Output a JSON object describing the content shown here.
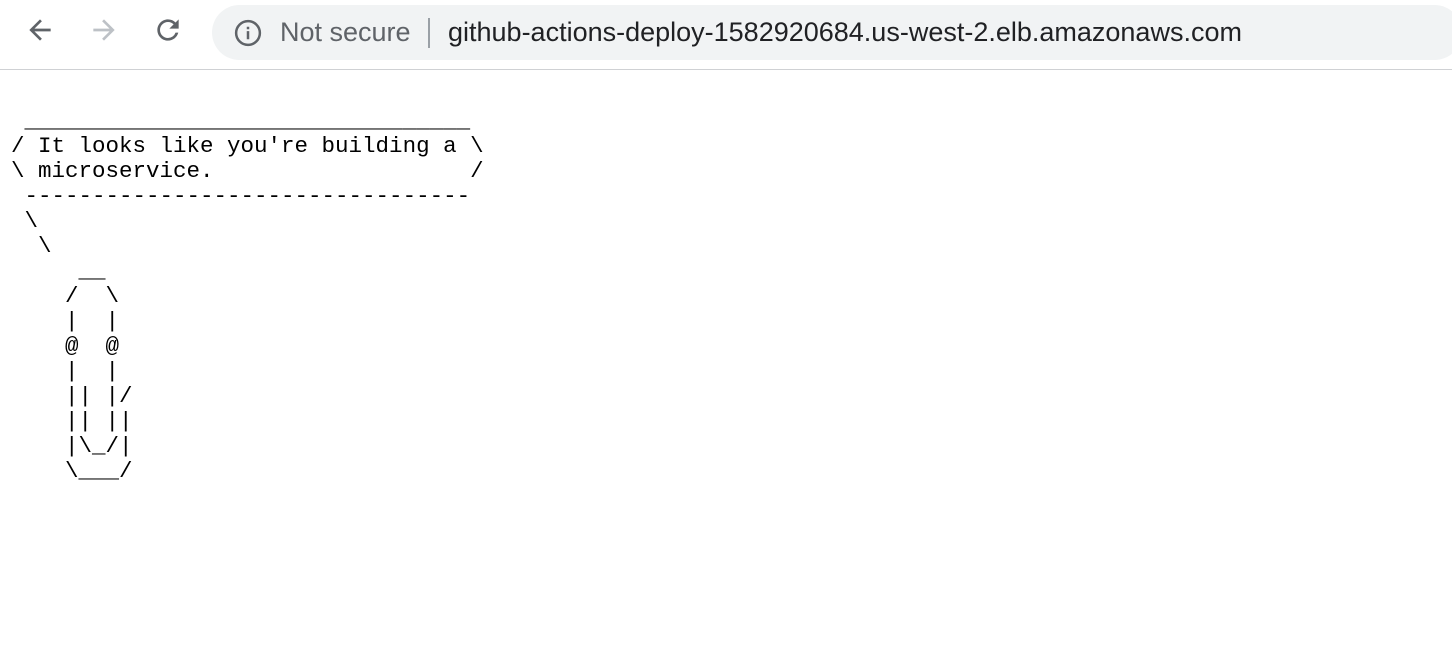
{
  "browser": {
    "back_icon": "arrow-left-icon",
    "forward_icon": "arrow-right-icon",
    "reload_icon": "reload-icon",
    "security_icon": "info-circle-icon",
    "security_label": "Not secure",
    "url": "github-actions-deploy-1582920684.us-west-2.elb.amazonaws.com"
  },
  "page": {
    "ascii_art": " _________________________________\n/ It looks like you're building a \\\n\\ microservice.                   /\n ---------------------------------\n \\\n  \\\n     __\n    /  \\\n    |  |\n    @  @\n    |  |\n    || |/\n    || ||\n    |\\_/|\n    \\___/"
  },
  "colors": {
    "toolbar_bg": "#ffffff",
    "omnibox_bg": "#f1f3f4",
    "icon_active": "#5f6368",
    "icon_disabled": "#bdc1c6",
    "url_text": "#202124",
    "security_text": "#5f6368"
  }
}
